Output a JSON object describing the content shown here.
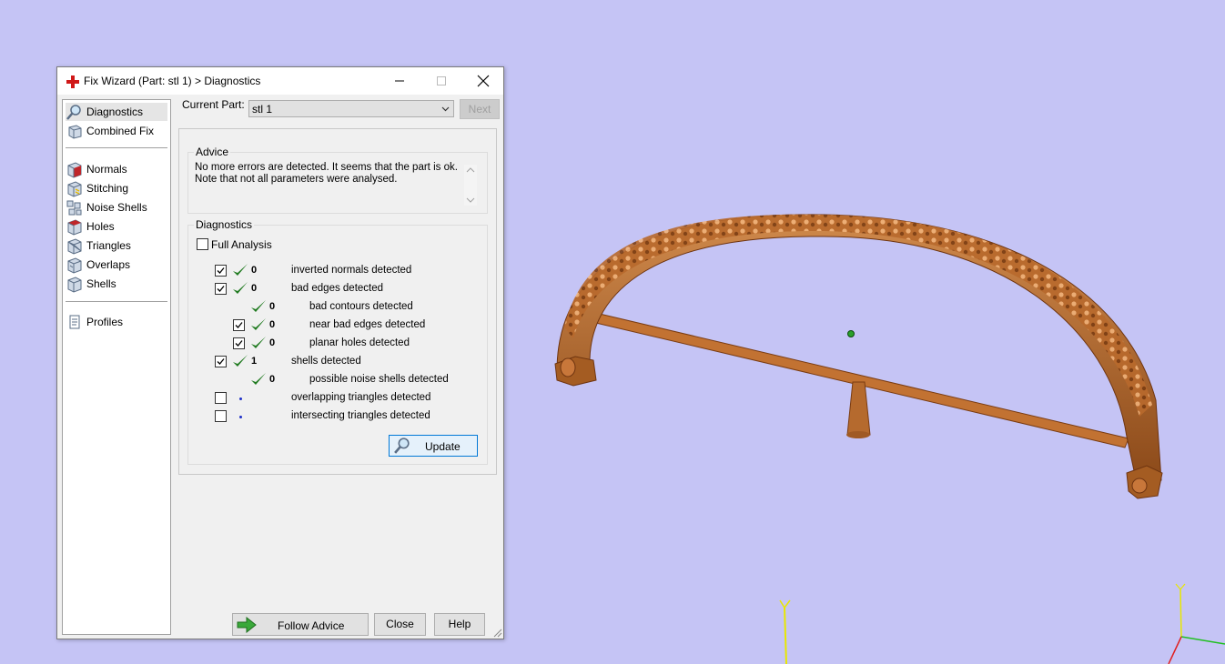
{
  "window": {
    "title": "Fix Wizard (Part: stl 1) > Diagnostics"
  },
  "sidebar": {
    "items": [
      {
        "label": "Diagnostics",
        "icon": "magnifier-icon"
      },
      {
        "label": "Combined Fix",
        "icon": "cube-icon"
      },
      {
        "label": "Normals",
        "icon": "normals-cube-icon"
      },
      {
        "label": "Stitching",
        "icon": "stitching-cube-icon"
      },
      {
        "label": "Noise Shells",
        "icon": "noise-shells-icon"
      },
      {
        "label": "Holes",
        "icon": "holes-cube-icon"
      },
      {
        "label": "Triangles",
        "icon": "triangles-cube-icon"
      },
      {
        "label": "Overlaps",
        "icon": "overlaps-cube-icon"
      },
      {
        "label": "Shells",
        "icon": "shells-cube-icon"
      },
      {
        "label": "Profiles",
        "icon": "document-icon"
      }
    ]
  },
  "current_part": {
    "label": "Current Part:",
    "value": "stl 1"
  },
  "next_label": "Next",
  "advice": {
    "title": "Advice",
    "text": "No more errors are detected. It seems that the part is ok.\nNote that not all parameters were analysed."
  },
  "diagnostics": {
    "title": "Diagnostics",
    "full_analysis_label": "Full Analysis",
    "rows": [
      {
        "count": "0",
        "label": "inverted normals detected"
      },
      {
        "count": "0",
        "label": "bad edges detected"
      },
      {
        "count": "0",
        "label": "bad contours detected"
      },
      {
        "count": "0",
        "label": "near bad edges detected"
      },
      {
        "count": "0",
        "label": "planar holes detected"
      },
      {
        "count": "1",
        "label": "shells detected"
      },
      {
        "count": "0",
        "label": "possible noise shells detected"
      },
      {
        "count": "",
        "label": "overlapping triangles detected"
      },
      {
        "count": "",
        "label": "intersecting triangles detected"
      }
    ],
    "update_label": "Update"
  },
  "footer": {
    "follow_advice_label": "Follow Advice",
    "close_label": "Close",
    "help_label": "Help"
  },
  "colors": {
    "background": "#c5c4f5",
    "model": "#c8773a",
    "check": "#1f7a1f"
  }
}
